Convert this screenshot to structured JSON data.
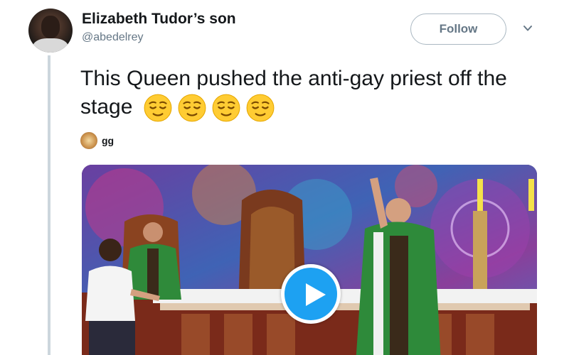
{
  "tweet": {
    "author_name": "Elizabeth Tudor’s son",
    "author_handle": "@abedelrey",
    "follow_label": "Follow",
    "text": "This Queen pushed the anti-gay priest off the stage",
    "emoji": [
      "relieved-face",
      "relieved-face",
      "relieved-face",
      "relieved-face"
    ],
    "mention_name": "gg"
  },
  "media": {
    "type": "video",
    "play_icon": "play-icon"
  },
  "colors": {
    "accent": "#1da1f2",
    "secondary_text": "#657786",
    "thread_line": "#ccd6dd"
  }
}
